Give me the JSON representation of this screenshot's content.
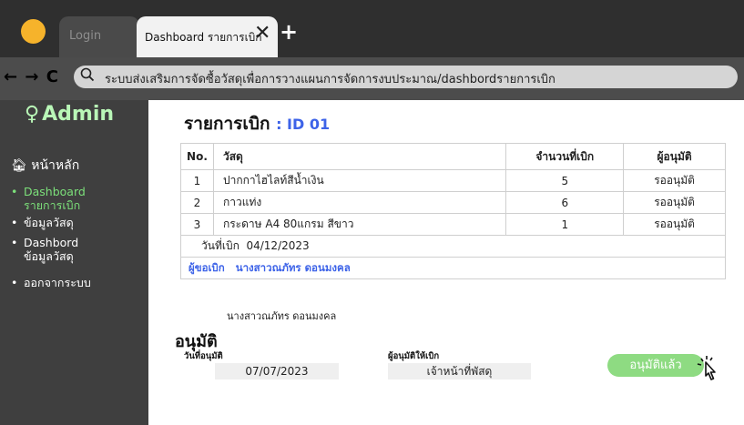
{
  "tabs": {
    "login": "Login",
    "dashboard": "Dashboard รายการเบิก",
    "close": "✕",
    "new": "+"
  },
  "nav": {
    "arrows": "← → C",
    "search_icon": "search-icon"
  },
  "address": {
    "url": "ระบบส่งเสริมการจัดซื้อวัสดุเพื่อการวางแผนการจัดการงบประมาณ/dashbordรายการเบิก"
  },
  "sidebar": {
    "brand": "Admin",
    "home": "หน้าหลัก",
    "items": [
      {
        "line1": "Dashboard",
        "line2": "รายการเบิก"
      },
      {
        "line1": "ข้อมูลวัสดุ",
        "line2": ""
      },
      {
        "line1": "Dashbord",
        "line2": "ข้อมูลวัสดุ"
      },
      {
        "line1": "ออกจากระบบ",
        "line2": ""
      }
    ],
    "active_color": "#7ce07a",
    "brand_color": "#b9f7b7"
  },
  "main": {
    "title": "รายการเบิก",
    "id": ": ID 01",
    "columns": [
      "No.",
      "วัสดุ",
      "จำนวนที่เบิก",
      "ผู้อนุมัติ"
    ],
    "rows": [
      {
        "no": "1",
        "material": "ปากกาไฮไลท์สีน้ำเงิน",
        "qty": "5",
        "approver": "รออนุมัติ"
      },
      {
        "no": "2",
        "material": "กาวแท่ง",
        "qty": "6",
        "approver": "รออนุมัติ"
      },
      {
        "no": "3",
        "material": "กระดาษ A4 80แกรม สีขาว",
        "qty": "1",
        "approver": "รออนุมัติ"
      }
    ],
    "withdraw_date_label": "วันที่เบิก",
    "withdraw_date": "04/12/2023",
    "requester_label": "ผู้ขอเบิก",
    "requester_name": "นางสาวณภัทร ดอนมงคล",
    "signature_name": "นางสาวณภัทร ดอนมงคล",
    "accent": "#3d63e8"
  },
  "approval": {
    "heading": "อนุมัติ",
    "date_label": "วันที่อนุมัติ",
    "date_value": "07/07/2023",
    "approver_label": "ผู้อนุมัติให้เบิก",
    "approver_value": "เจ้าหน้าที่พัสดุ",
    "button": "อนุมัติแล้ว",
    "button_color": "#8edb82"
  }
}
